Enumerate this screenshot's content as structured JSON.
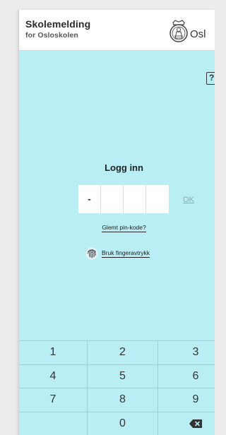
{
  "header": {
    "title": "Skolemelding",
    "subtitle": "for Osloskolen",
    "brand_text": "Osl",
    "logo_icon": "oslo-crest-icon"
  },
  "login": {
    "help_label": "?",
    "title": "Logg inn",
    "pin_values": [
      "-",
      "",
      "",
      ""
    ],
    "ok_label": "OK",
    "forgot_label": "Glemt pin-kode?",
    "fingerprint_label": "Bruk fingeravtrykk",
    "fingerprint_icon": "fingerprint-icon"
  },
  "keypad": {
    "keys": [
      "1",
      "2",
      "3",
      "4",
      "5",
      "6",
      "7",
      "8",
      "9",
      "",
      "0",
      "⌫"
    ],
    "delete_icon": "backspace-icon"
  },
  "colors": {
    "background": "#b8eef4",
    "header": "#ffffff",
    "text": "#222222",
    "ok_disabled": "#8ba7ab"
  }
}
